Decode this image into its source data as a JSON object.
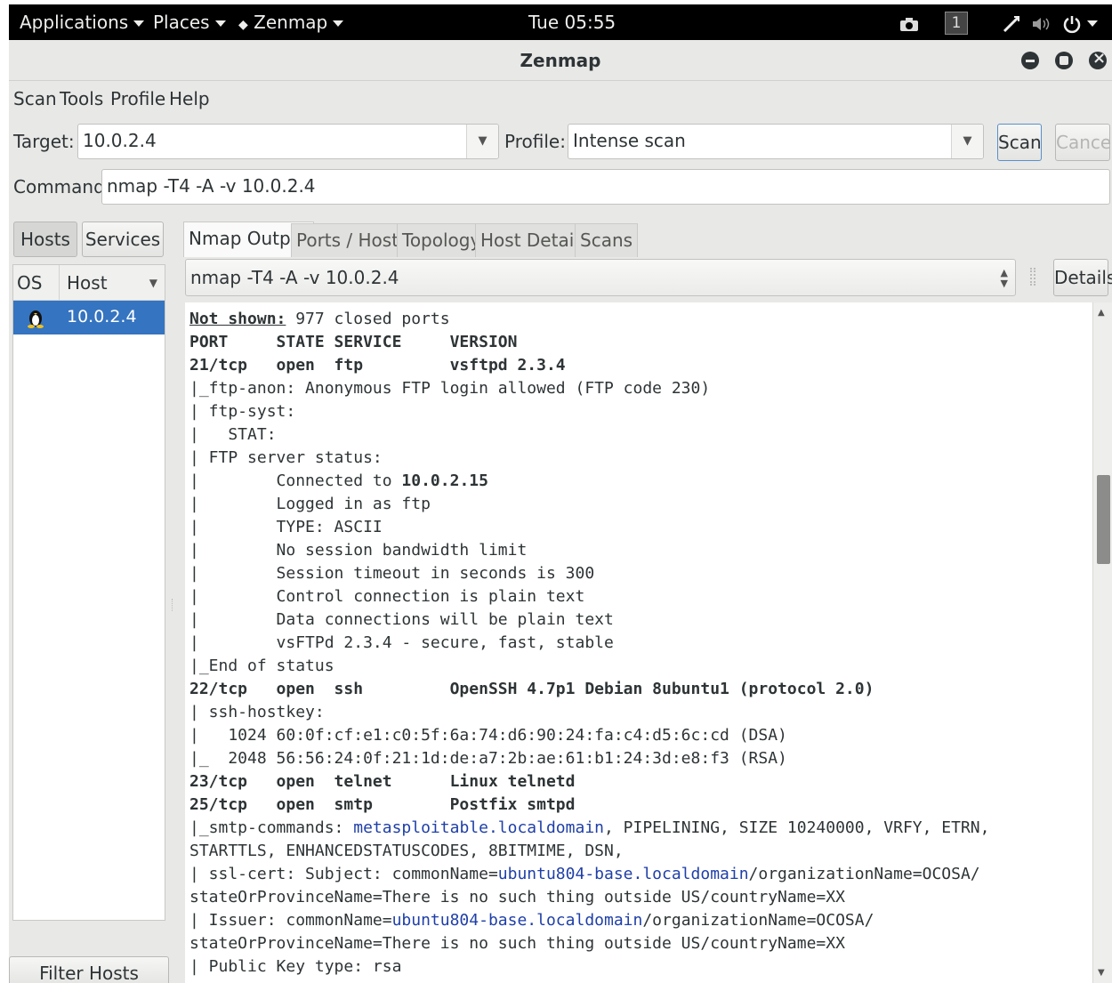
{
  "topbar": {
    "applications": "Applications",
    "places": "Places",
    "app_name": "Zenmap",
    "clock": "Tue 05:55",
    "workspace": "1",
    "icons": [
      "screenshot-icon",
      "network-icon",
      "volume-icon",
      "power-icon"
    ]
  },
  "window": {
    "title": "Zenmap"
  },
  "menu": [
    "Scan",
    "Tools",
    "Profile",
    "Help"
  ],
  "toolbar": {
    "target_label": "Target:",
    "target_value": "10.0.2.4",
    "profile_label": "Profile:",
    "profile_value": "Intense scan",
    "scan_button": "Scan",
    "cancel_button": "Cancel",
    "command_label": "Command:",
    "command_value": "nmap -T4 -A -v 10.0.2.4"
  },
  "left": {
    "hosts_button": "Hosts",
    "services_button": "Services",
    "col_os": "OS",
    "col_host": "Host",
    "host_row": "10.0.2.4",
    "filter_button": "Filter Hosts"
  },
  "tabs": [
    "Nmap Output",
    "Ports / Hosts",
    "Topology",
    "Host Details",
    "Scans"
  ],
  "output_header": {
    "command": "nmap -T4 -A -v 10.0.2.4",
    "details_button": "Details"
  },
  "output": {
    "not_shown_label": "Not shown:",
    "not_shown_value": " 977 closed ports",
    "header": "PORT     STATE SERVICE     VERSION",
    "l21": "21/tcp   open  ftp         vsftpd 2.3.4",
    "l_anon": "|_ftp-anon: Anonymous FTP login allowed (FTP code 230)",
    "l_syst": "| ftp-syst:",
    "l_stat": "|   STAT:",
    "l_ftpstatus": "| FTP server status:",
    "l_connected_pre": "|        Connected to ",
    "l_connected_ip": "10.0.2.15",
    "l_logged": "|        Logged in as ftp",
    "l_type": "|        TYPE: ASCII",
    "l_nobw": "|        No session bandwidth limit",
    "l_timeout": "|        Session timeout in seconds is 300",
    "l_control": "|        Control connection is plain text",
    "l_data": "|        Data connections will be plain text",
    "l_vsftpd": "|        vsFTPd 2.3.4 - secure, fast, stable",
    "l_end": "|_End of status",
    "l22": "22/tcp   open  ssh         OpenSSH 4.7p1 Debian 8ubuntu1 (protocol 2.0)",
    "l_hostkey": "| ssh-hostkey:",
    "l_dsa": "|   1024 60:0f:cf:e1:c0:5f:6a:74:d6:90:24:fa:c4:d5:6c:cd (DSA)",
    "l_rsa": "|_  2048 56:56:24:0f:21:1d:de:a7:2b:ae:61:b1:24:3d:e8:f3 (RSA)",
    "l23": "23/tcp   open  telnet      Linux telnetd",
    "l25": "25/tcp   open  smtp        Postfix smtpd",
    "l_smtp_pre": "|_smtp-commands: ",
    "l_smtp_host": "metasploitable.localdomain",
    "l_smtp_post": ", PIPELINING, SIZE 10240000, VRFY, ETRN,",
    "l_starttls": "STARTTLS, ENHANCEDSTATUSCODES, 8BITMIME, DSN,",
    "l_ssl_pre": "| ssl-cert: Subject: commonName=",
    "l_ssl_host": "ubuntu804-base.localdomain",
    "l_ssl_post": "/organizationName=OCOSA/",
    "l_state1": "stateOrProvinceName=There is no such thing outside US/countryName=XX",
    "l_issuer_pre": "| Issuer: commonName=",
    "l_issuer_host": "ubuntu804-base.localdomain",
    "l_issuer_post": "/organizationName=OCOSA/",
    "l_state2": "stateOrProvinceName=There is no such thing outside US/countryName=XX",
    "l_pubkey": "| Public Key type: rsa"
  }
}
